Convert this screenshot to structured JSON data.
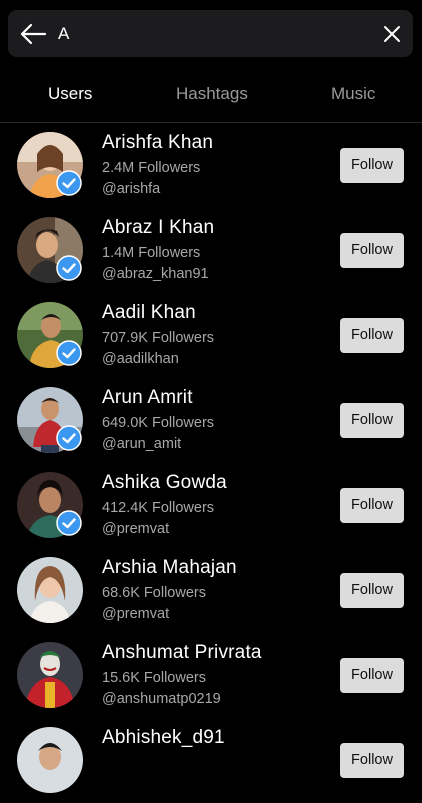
{
  "search": {
    "query": "A",
    "back_icon": "arrow-left-icon",
    "clear_icon": "close-icon"
  },
  "tabs": [
    {
      "label": "Users",
      "active": true
    },
    {
      "label": "Hashtags",
      "active": false
    },
    {
      "label": "Music",
      "active": false
    }
  ],
  "colors": {
    "background": "#000000",
    "search_bg": "#1c1c1e",
    "verified_blue": "#3b97f0",
    "button_bg": "#dcdcdc",
    "muted_text": "#a8a8a8"
  },
  "users": [
    {
      "name": "Arishfa Khan",
      "followers": "2.4M Followers",
      "handle": "@arishfa",
      "verified": true,
      "button": "Follow"
    },
    {
      "name": "Abraz I Khan",
      "followers": "1.4M Followers",
      "handle": "@abraz_khan91",
      "verified": true,
      "button": "Follow"
    },
    {
      "name": "Aadil Khan",
      "followers": "707.9K Followers",
      "handle": "@aadilkhan",
      "verified": true,
      "button": "Follow"
    },
    {
      "name": "Arun Amrit",
      "followers": "649.0K Followers",
      "handle": "@arun_amit",
      "verified": true,
      "button": "Follow"
    },
    {
      "name": "Ashika Gowda",
      "followers": "412.4K Followers",
      "handle": "@premvat",
      "verified": true,
      "button": "Follow"
    },
    {
      "name": "Arshia Mahajan",
      "followers": "68.6K Followers",
      "handle": "@premvat",
      "verified": false,
      "button": "Follow"
    },
    {
      "name": "Anshumat Privrata",
      "followers": "15.6K Followers",
      "handle": "@anshumatp0219",
      "verified": false,
      "button": "Follow"
    },
    {
      "name": "Abhishek_d91",
      "followers": "",
      "handle": "",
      "verified": false,
      "button": "Follow"
    }
  ]
}
